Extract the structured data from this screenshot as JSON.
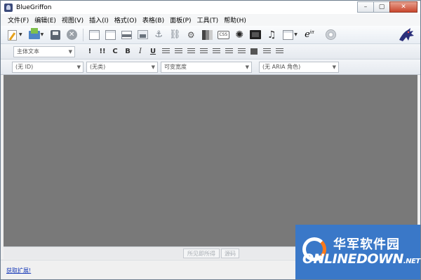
{
  "window": {
    "title": "BlueGriffon",
    "controls": {
      "minimize": "–",
      "maximize": "▢",
      "close": "✕"
    }
  },
  "menubar": {
    "items": [
      {
        "label": "文件(F)"
      },
      {
        "label": "编辑(E)"
      },
      {
        "label": "视图(V)"
      },
      {
        "label": "插入(I)"
      },
      {
        "label": "格式(O)"
      },
      {
        "label": "表格(B)"
      },
      {
        "label": "面板(P)"
      },
      {
        "label": "工具(T)"
      },
      {
        "label": "帮助(H)"
      }
    ]
  },
  "toolbar_main": {
    "icons": [
      "new-document-icon",
      "open-file-icon",
      "save-icon",
      "close-icon",
      "panel-icon",
      "panel-alt-icon",
      "horizontal-rule-icon",
      "image-icon",
      "anchor-icon",
      "link-icon",
      "form-icon",
      "table-icon",
      "css-icon",
      "settings-icon",
      "video-icon",
      "audio-icon",
      "page-icon",
      "math-icon",
      "disc-icon",
      "dragon-logo-icon"
    ],
    "math_label": "e",
    "math_sup": "iπ",
    "css_label": "CSS"
  },
  "toolbar_format": {
    "paragraph_style": "主体文本",
    "buttons": {
      "emphasis": "!",
      "strong_emphasis": "!!",
      "code": "C",
      "bold": "B",
      "italic": "I",
      "underline": "U"
    }
  },
  "toolbar_attributes": {
    "id_select": "(无 ID)",
    "class_select": "(无类)",
    "width_select": "可变宽度",
    "aria_select": "(无 ARIA 角色)"
  },
  "mode_bar": {
    "wysiwyg": "所见即所得",
    "source": "源码"
  },
  "status": {
    "get_extensions": "获取扩展!"
  },
  "watermark": {
    "cn": "华军软件园",
    "en": "ONLINEDOWN",
    "en_suffix": ".NET"
  }
}
